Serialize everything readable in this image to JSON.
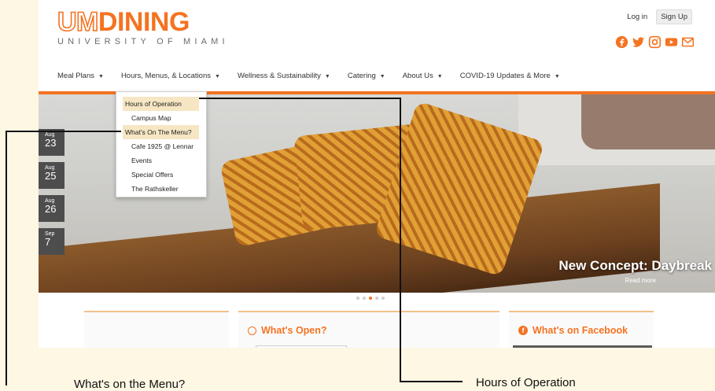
{
  "header": {
    "logo_um": "UM",
    "logo_dining": "DINING",
    "logo_sub": "UNIVERSITY OF MIAMI",
    "login": "Log in",
    "signup": "Sign Up"
  },
  "social_icons": [
    "facebook-icon",
    "twitter-icon",
    "instagram-icon",
    "youtube-icon",
    "mail-icon"
  ],
  "nav": [
    {
      "label": "Meal Plans"
    },
    {
      "label": "Hours, Menus, & Locations"
    },
    {
      "label": "Wellness & Sustainability"
    },
    {
      "label": "Catering"
    },
    {
      "label": "About Us"
    },
    {
      "label": "COVID-19 Updates & More"
    }
  ],
  "dropdown": [
    {
      "label": "Hours of Operation"
    },
    {
      "label": "Campus Map"
    },
    {
      "label": "What's On The Menu?"
    },
    {
      "label": "Cafe 1925 @ Lennar"
    },
    {
      "label": "Events"
    },
    {
      "label": "Special Offers"
    },
    {
      "label": "The Rathskeller"
    }
  ],
  "dates": [
    {
      "month": "Aug",
      "day": "23"
    },
    {
      "month": "Aug",
      "day": "25"
    },
    {
      "month": "Aug",
      "day": "26"
    },
    {
      "month": "Sep",
      "day": "7"
    }
  ],
  "hero": {
    "title": "New Concept: Daybreak",
    "read_more": "Read more"
  },
  "carousel": {
    "count": 5,
    "active_index": 2
  },
  "panels": {
    "whats_open": "What's Open?",
    "facebook": "What's on Facebook"
  },
  "callouts": {
    "menu": "What's on the Menu?",
    "hours": "Hours of Operation"
  },
  "colors": {
    "accent": "#f47321",
    "highlight": "#f6e6c3",
    "background": "#fdf7e3"
  }
}
